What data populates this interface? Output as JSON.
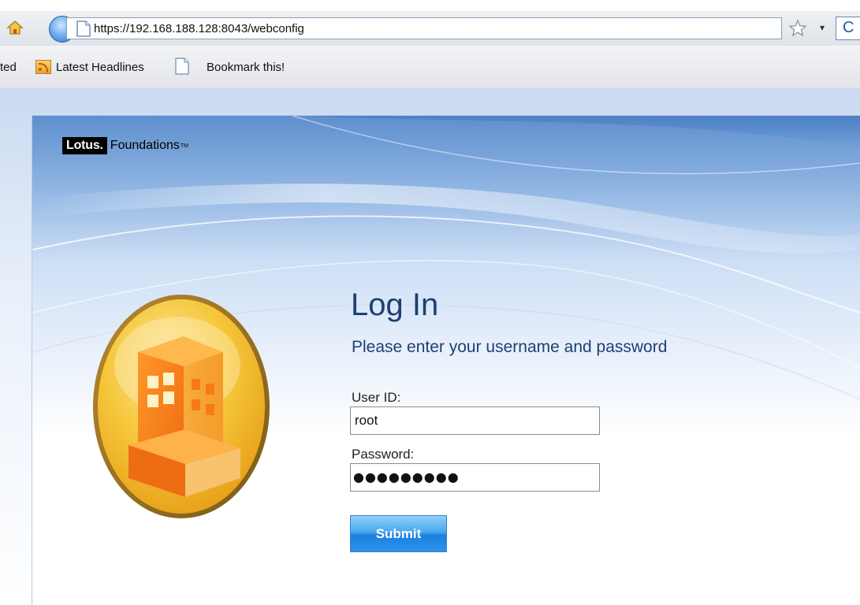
{
  "browser": {
    "url": "https://192.168.188.128:8043/webconfig",
    "refresh_glyph": "C",
    "dropdown_glyph": "▾"
  },
  "bookmarks": {
    "partial_label": "ted",
    "items": [
      "Latest Headlines",
      "Bookmark this!"
    ]
  },
  "brand": {
    "lotus": "Lotus.",
    "foundations": "Foundations",
    "tm": "TM"
  },
  "login": {
    "title": "Log In",
    "subtitle": "Please enter your username and password",
    "userid_label": "User ID:",
    "userid_value": "root",
    "password_label": "Password:",
    "password_mask": "●●●●●●●●●",
    "submit_label": "Submit"
  },
  "colors": {
    "title_blue": "#1f3f72",
    "button_blue": "#2a93ec",
    "emblem_gold": "#f4b928",
    "emblem_orange": "#f07d1a"
  }
}
